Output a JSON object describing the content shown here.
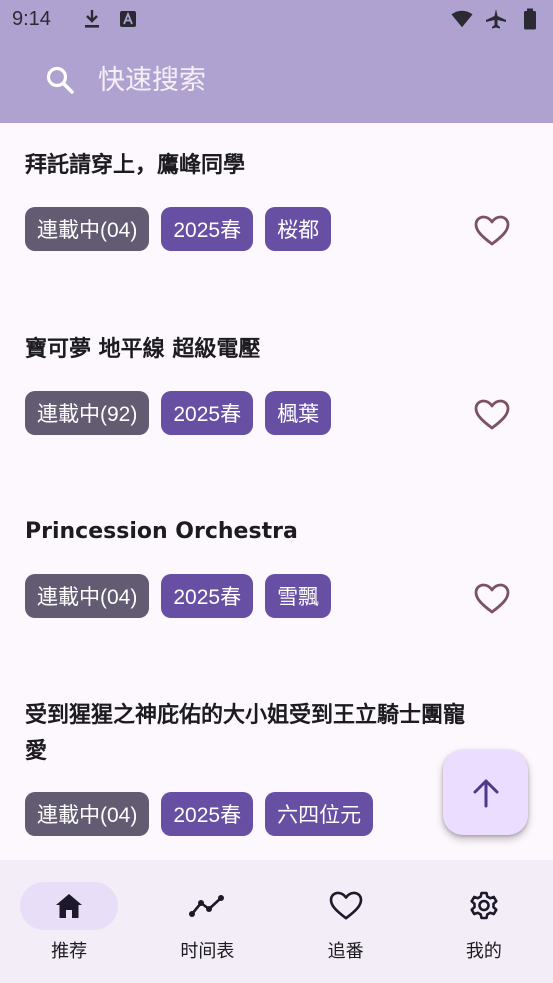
{
  "status_bar": {
    "time": "9:14",
    "icons": [
      "download-icon",
      "a-notification-icon",
      "wifi-icon",
      "airplane-icon",
      "battery-icon"
    ]
  },
  "search": {
    "placeholder": "快速搜索"
  },
  "colors": {
    "header_bg": "#b0a2d0",
    "status_tag": "#625b71",
    "accent_tag": "#6750a4",
    "fab_bg": "#eaddff",
    "nav_bg": "#f3edf7",
    "nav_active_pill": "#e8def8",
    "heart_stroke": "#7d5260"
  },
  "items": [
    {
      "title": "拜託請穿上，鷹峰同學",
      "status": "連載中(04)",
      "season": "2025春",
      "studio": "桜都"
    },
    {
      "title": "寶可夢 地平線 超級電壓",
      "status": "連載中(92)",
      "season": "2025春",
      "studio": "楓葉"
    },
    {
      "title": "Princession Orchestra",
      "status": "連載中(04)",
      "season": "2025春",
      "studio": "雪飄"
    },
    {
      "title": "受到猩猩之神庇佑的大小姐受到王立騎士團寵愛",
      "status": "連載中(04)",
      "season": "2025春",
      "studio": "六四位元"
    }
  ],
  "nav": {
    "items": [
      {
        "label": "推荐",
        "icon": "home-icon",
        "active": true
      },
      {
        "label": "时间表",
        "icon": "timeline-icon",
        "active": false
      },
      {
        "label": "追番",
        "icon": "heart-icon",
        "active": false
      },
      {
        "label": "我的",
        "icon": "gear-icon",
        "active": false
      }
    ]
  }
}
